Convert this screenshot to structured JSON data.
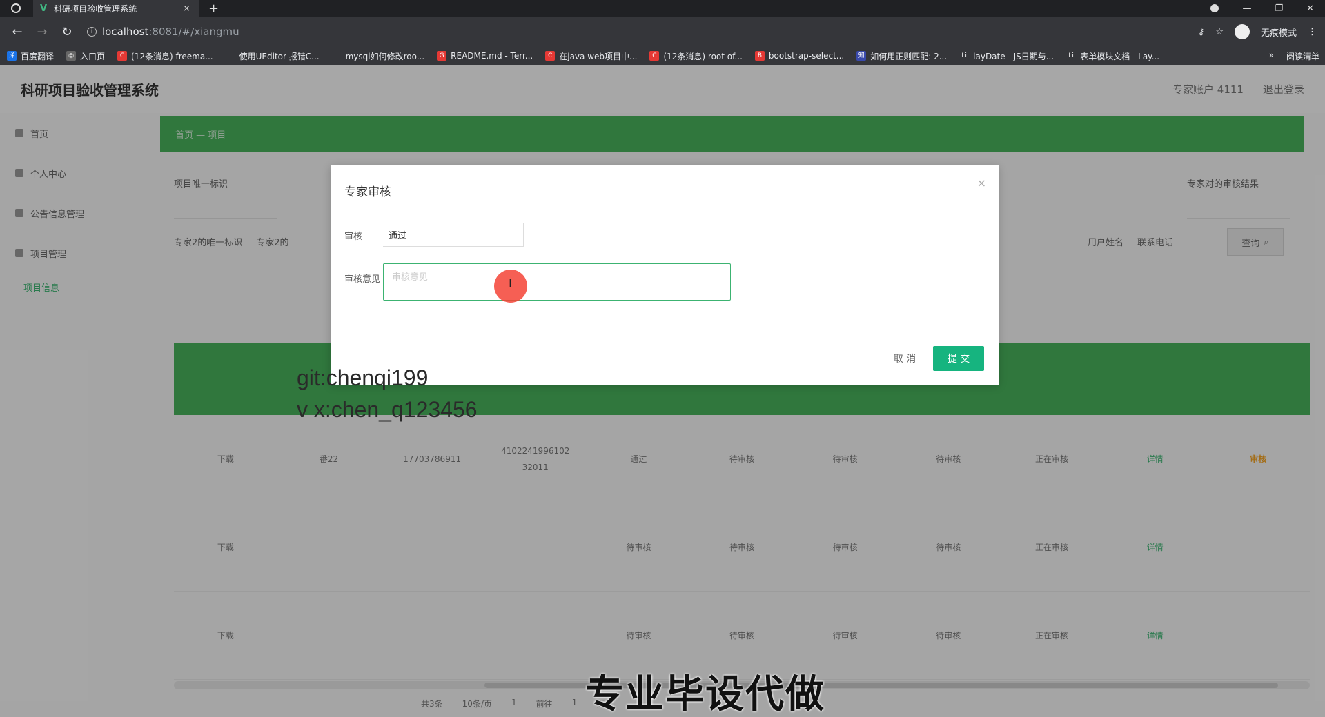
{
  "browser": {
    "tab_title": "科研项目验收管理系统",
    "tab_close": "×",
    "new_tab": "+",
    "url_host": "localhost",
    "url_rest": ":8081/#/xiangmu",
    "incognito": "无痕模式",
    "bookmarks": [
      {
        "label": "百度翻译",
        "color": "#1a73e8",
        "icon": "译"
      },
      {
        "label": "入口页",
        "color": "#666",
        "icon": "◎"
      },
      {
        "label": "(12条消息) freema...",
        "color": "#e53935",
        "icon": "C"
      },
      {
        "label": "使用UEditor 报错C...",
        "color": "#35363a",
        "icon": ""
      },
      {
        "label": "mysql如何修改roo...",
        "color": "#35363a",
        "icon": ""
      },
      {
        "label": "README.md - Terr...",
        "color": "#e53935",
        "icon": "G"
      },
      {
        "label": "在java web项目中...",
        "color": "#e53935",
        "icon": "C"
      },
      {
        "label": "(12条消息) root of...",
        "color": "#e53935",
        "icon": "C"
      },
      {
        "label": "bootstrap-select...",
        "color": "#e53935",
        "icon": "B"
      },
      {
        "label": "如何用正则匹配: 2...",
        "color": "#3949ab",
        "icon": "知"
      },
      {
        "label": "layDate - JS日期与...",
        "color": "#35363a",
        "icon": "Li"
      },
      {
        "label": "表单模块文档 - Lay...",
        "color": "#35363a",
        "icon": "Li"
      }
    ],
    "bookmarks_more": "»",
    "reading_list": "阅读清单"
  },
  "app": {
    "title": "科研项目验收管理系统",
    "user": "专家账户 4111",
    "logout": "退出登录",
    "sidebar": [
      {
        "label": "首页",
        "sub": false
      },
      {
        "label": "个人中心",
        "sub": false
      },
      {
        "label": "公告信息管理",
        "sub": false
      },
      {
        "label": "项目管理",
        "sub": false
      },
      {
        "label": "项目信息",
        "sub": true
      }
    ],
    "breadcrumb": "首页 — 项目",
    "search_labels": [
      "项目唯一标识",
      "专家对的审核结果"
    ],
    "search_labels2": [
      "专家2的唯一标识",
      "专家2的",
      "用户姓名",
      "联系电话"
    ],
    "search_button": "查询",
    "rows": [
      {
        "cells": [
          "下载",
          "番22",
          "17703786911",
          "4102241996102\n32011",
          "通过",
          "待审核",
          "待审核",
          "待审核",
          "正在审核",
          "详情",
          "审核"
        ]
      },
      {
        "cells": [
          "下载",
          "",
          "",
          "",
          "待审核",
          "待审核",
          "待审核",
          "待审核",
          "正在审核",
          "详情",
          ""
        ]
      },
      {
        "cells": [
          "下载",
          "",
          "",
          "",
          "待审核",
          "待审核",
          "待审核",
          "待审核",
          "正在审核",
          "详情",
          ""
        ]
      }
    ],
    "pager": [
      "共3条",
      "10条/页",
      "1",
      "前往",
      "1",
      "页"
    ]
  },
  "modal": {
    "title": "专家审核",
    "close": "×",
    "audit_label": "审核",
    "audit_value": "通过",
    "opinion_label": "审核意见",
    "opinion_placeholder": "审核意见",
    "cancel": "取 消",
    "submit": "提 交"
  },
  "watermarks": {
    "git": "git:chenqi199",
    "vx": "v x:chen_q123456",
    "banner": "专业毕设代做"
  }
}
